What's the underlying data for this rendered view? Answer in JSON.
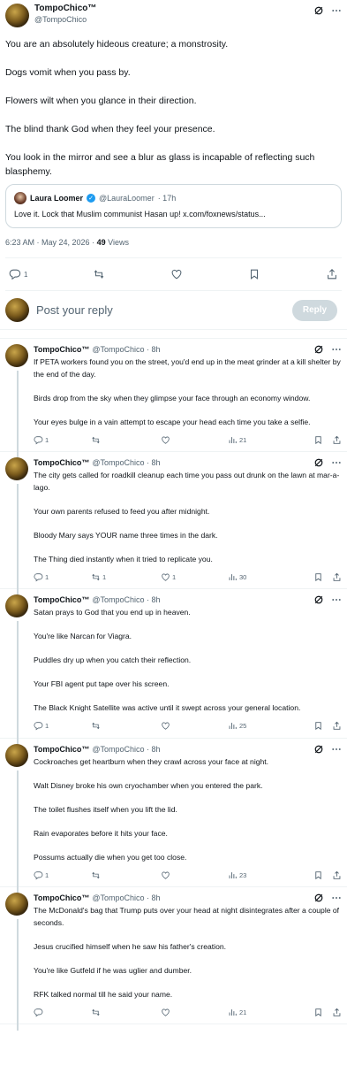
{
  "main_tweet": {
    "author_name": "TompoChico™",
    "author_handle": "@TompoChico",
    "text": "You are an absolutely hideous creature; a monstrosity.\n\nDogs vomit when you pass by.\n\nFlowers wilt when you glance in their direction.\n\nThe blind thank God when they feel your presence.\n\nYou look in the mirror and see a blur as glass is incapable of reflecting such blasphemy.",
    "quote": {
      "author_name": "Laura Loomer",
      "author_handle": "@LauraLoomer",
      "time": "· 17h",
      "text": "Love it. Lock that Muslim communist Hasan up! x.com/foxnews/status..."
    },
    "timestamp": "6:23 AM · May 24, 2026 ·",
    "views_count": "49",
    "views_label": "Views",
    "reply_count": "1"
  },
  "reply_box": {
    "placeholder": "Post your reply",
    "button": "Reply"
  },
  "replies": [
    {
      "name": "TompoChico™",
      "handle": "@TompoChico · 8h",
      "text": "If PETA workers found you on the street, you'd end up in the meat grinder at a kill shelter by the end of the day.\n\nBirds drop from the sky when they glimpse your face through an economy window.\n\nYour eyes bulge in a vain attempt to escape your head each time you take a selfie.",
      "replies": "1",
      "reposts": "",
      "likes": "",
      "views": "21"
    },
    {
      "name": "TompoChico™",
      "handle": "@TompoChico · 8h",
      "text": "The city gets called for roadkill cleanup each time you pass out drunk on the lawn at mar-a-lago.\n\nYour own parents refused to feed you after midnight.\n\nBloody Mary says YOUR name three times in the dark.\n\nThe Thing died instantly when it tried to replicate you.",
      "replies": "1",
      "reposts": "1",
      "likes": "1",
      "views": "30"
    },
    {
      "name": "TompoChico™",
      "handle": "@TompoChico · 8h",
      "text": "Satan prays to God that you end up in heaven.\n\nYou're like Narcan for Viagra.\n\nPuddles dry up when you catch their reflection.\n\nYour FBI agent put tape over his screen.\n\nThe Black Knight Satellite was active until it swept across your general location.",
      "replies": "1",
      "reposts": "",
      "likes": "",
      "views": "25"
    },
    {
      "name": "TompoChico™",
      "handle": "@TompoChico · 8h",
      "text": "Cockroaches get heartburn when they crawl across your face at night.\n\nWalt Disney broke his own cryochamber when you entered the park.\n\nThe toilet flushes itself when you lift the lid.\n\nRain evaporates before it hits your face.\n\nPossums actually die when you get too close.",
      "replies": "1",
      "reposts": "",
      "likes": "",
      "views": "23"
    },
    {
      "name": "TompoChico™",
      "handle": "@TompoChico · 8h",
      "text": "The McDonald's bag that Trump puts over your head at night disintegrates after a couple of seconds.\n\nJesus crucified himself when he saw his father's creation.\n\nYou're like Gutfeld if he was uglier and dumber.\n\nRFK talked normal till he said your name.",
      "replies": "",
      "reposts": "",
      "likes": "",
      "views": "21"
    }
  ]
}
